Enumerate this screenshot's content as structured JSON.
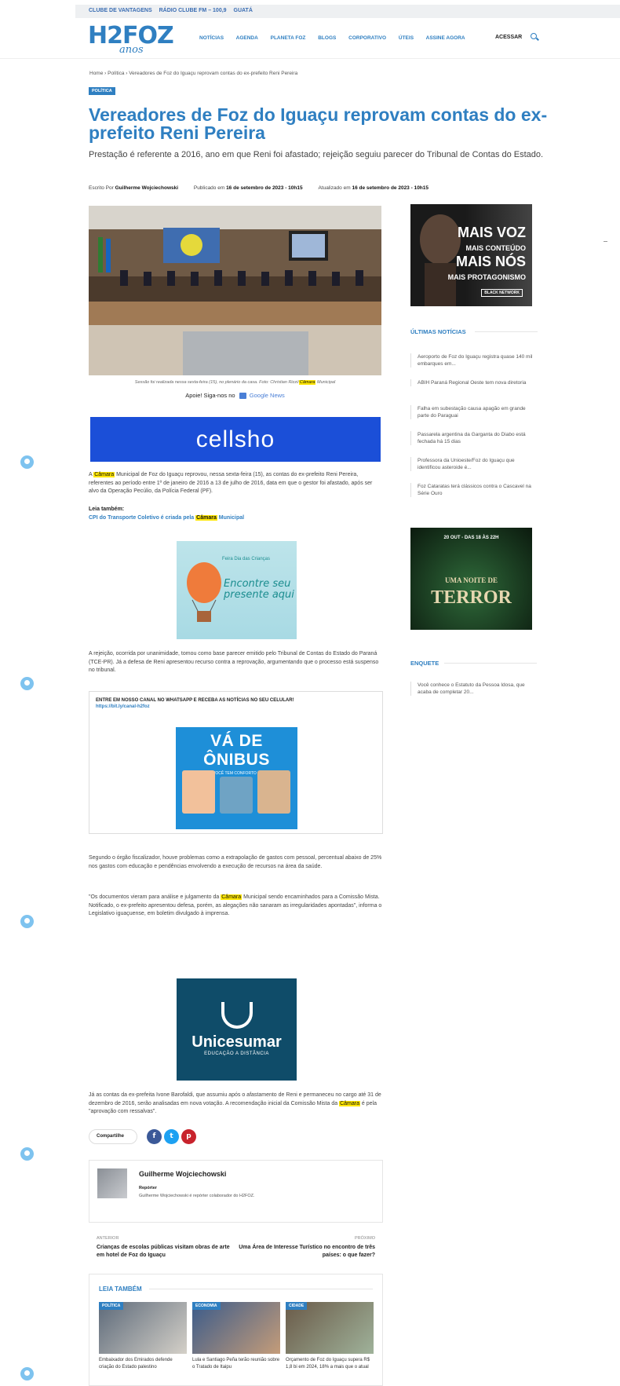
{
  "topbar": {
    "links": [
      "CLUBE DE VANTAGENS",
      "RÁDIO CLUBE FM – 100,9",
      "GUATÁ"
    ]
  },
  "logo": {
    "main": "H2FOZ",
    "sub": "anos"
  },
  "nav": {
    "items": [
      "NOTÍCIAS",
      "AGENDA",
      "PLANETA FOZ",
      "BLOGS",
      "CORPORATIVO",
      "ÚTEIS",
      "ASSINE AGORA"
    ],
    "login": "ACESSAR"
  },
  "breadcrumb": "Home  ›  Política  ›  Vereadores de Foz do Iguaçu reprovam contas do ex-prefeito Reni Pereira",
  "article": {
    "category": "POLÍTICA",
    "title": "Vereadores de Foz do Iguaçu reprovam contas do ex-prefeito Reni Pereira",
    "lead": "Prestação é referente a 2016, ano em que Reni foi afastado; rejeição seguiu parecer do Tribunal de Contas do Estado.",
    "byline_label": "Escrito Por",
    "author": "Guilherme Wojciechowski",
    "published_label": "Publicado em",
    "published": "16 de setembro de 2023 - 10h15",
    "updated_label": "Atualizado em",
    "updated": "16 de setembro de 2023 - 10h15",
    "caption_a": "Sessão foi realizada nessa sexta-feira (15), no plenário da casa. Foto: Christian Rizzi/",
    "caption_mark": "Câmara",
    "caption_b": " Municipal",
    "gnews_label": "Apoie! Siga-nos no",
    "gnews_name": "Google News",
    "ad_cellshop": "cellsho",
    "p1_mark": "Câmara",
    "p1": " Municipal de Foz do Iguaçu reprovou, nessa sexta-feira (15), as contas do ex-prefeito Reni Pereira, referentes ao período entre 1º de janeiro de 2016 a 13 de julho de 2016, data em que o gestor foi afastado, após ser alvo da Operação Pecúlio, da Polícia Federal (PF).",
    "p1_prefix": "A ",
    "leia_label": "Leia também:",
    "leia_link_a": "CPI do Transporte Coletivo é criada pela ",
    "leia_link_mark": "Câmara",
    "leia_link_b": " Municipal",
    "ad_kids_top": "Feira Dia das Crianças",
    "ad_kids_text": "Encontre seu presente aqui",
    "p2": "A rejeição, ocorrida por unanimidade, tomou como base parecer emitido pelo Tribunal de Contas do Estado do Paraná (TCE-PR). Já a defesa de Reni apresentou recurso contra a reprovação, argumentando que o processo está suspenso no tribunal.",
    "whatsapp_title": "ENTRE EM NOSSO CANAL NO WHATSAPP E RECEBA AS NOTÍCIAS NO SEU CELULAR!",
    "whatsapp_link": "https://bit.ly/canal-h2foz",
    "ad_onibus": "VÁ DE ÔNIBUS",
    "ad_onibus_sub": "COM A VIAAC VOCÊ TEM CONFORTO E TECNOLOGIA",
    "p3": "Segundo o órgão fiscalizador, houve problemas como a extrapolação de gastos com pessoal, percentual abaixo de 25% nos gastos com educação e pendências envolvendo a execução de recursos na área da saúde.",
    "p4_a": "\"Os documentos vieram para análise e julgamento da ",
    "p4_mark": "Câmara",
    "p4_b": " Municipal sendo encaminhados para a Comissão Mista. Notificado, o ex-prefeito apresentou defesa, porém, as alegações não sanaram as irregularidades apontadas\", informa o Legislativo iguaçuense, em boletim divulgado à imprensa.",
    "ad_unicesumar": "Unicesumar",
    "ad_unicesumar_sub": "EDUCAÇÃO A DISTÂNCIA",
    "p5_a": "Já as contas da ex-prefeita Ivone Barofaldi, que assumiu após o afastamento de Reni e permaneceu no cargo até 31 de dezembro de 2016, serão analisadas em nova votação. A recomendação inicial da Comissão Mista da ",
    "p5_mark": "Câmara",
    "p5_b": " é pela \"aprovação com ressalvas\".",
    "share_label": "Compartilhe"
  },
  "author_box": {
    "name": "Guilherme Wojciechowski",
    "role": "Repórter",
    "bio": "Guilherme Wojciechowski é repórter colaborador do H2FOZ."
  },
  "prevnext": {
    "prev_label": "ANTERIOR",
    "prev_title": "Crianças de escolas públicas visitam obras de arte em hotel de Foz do Iguaçu",
    "next_label": "PRÓXIMO",
    "next_title": "Uma Área de Interesse Turístico no encontro de três países: o que fazer?"
  },
  "related": {
    "heading": "LEIA TAMBÉM",
    "cards": [
      {
        "cat": "POLÍTICA",
        "title": "Embaixador dos Emirados defende criação do Estado palestino"
      },
      {
        "cat": "ECONOMIA",
        "title": "Lula e Santiago Peña terão reunião sobre o Tratado de Itaipu"
      },
      {
        "cat": "CIDADE",
        "title": "Orçamento de Foz do Iguaçu supera R$ 1,8 bi em 2024, 18% a mais que o atual"
      }
    ]
  },
  "sidebar": {
    "ad1_line1": "MAIS VOZ",
    "ad1_line2": "MAIS CONTEÚDO",
    "ad1_line3": "MAIS NÓS",
    "ad1_line4": "MAIS PROTAGONISMO",
    "ad1_brand": "BLACK NETWORK",
    "latest_heading": "ÚLTIMAS NOTÍCIAS",
    "latest": [
      "Aeroporto de Foz do Iguaçu registra quase 140 mil embarques em...",
      "ABIH Paraná Regional Oeste tem nova diretoria",
      "Falha em subestação causa apagão em grande parte do Paraguai",
      "Passarela argentina da Garganta do Diabo está fechada há 15 dias",
      "Professora da Unioeste/Foz do Iguaçu que identificou asteroide é...",
      "Foz Cataratas terá clássicos contra o Cascavel na Série Ouro"
    ],
    "ad2_date": "20 OUT - DAS 18 ÀS 22H",
    "ad2_small": "UMA NOITE DE",
    "ad2_title": "TERROR",
    "poll_heading": "ENQUETE",
    "poll_item": "Você conhece o Estatuto da Pessoa Idosa, que acaba de completar 20..."
  },
  "colors": {
    "accent": "#2f7fc1",
    "highlight": "#ffe600"
  }
}
